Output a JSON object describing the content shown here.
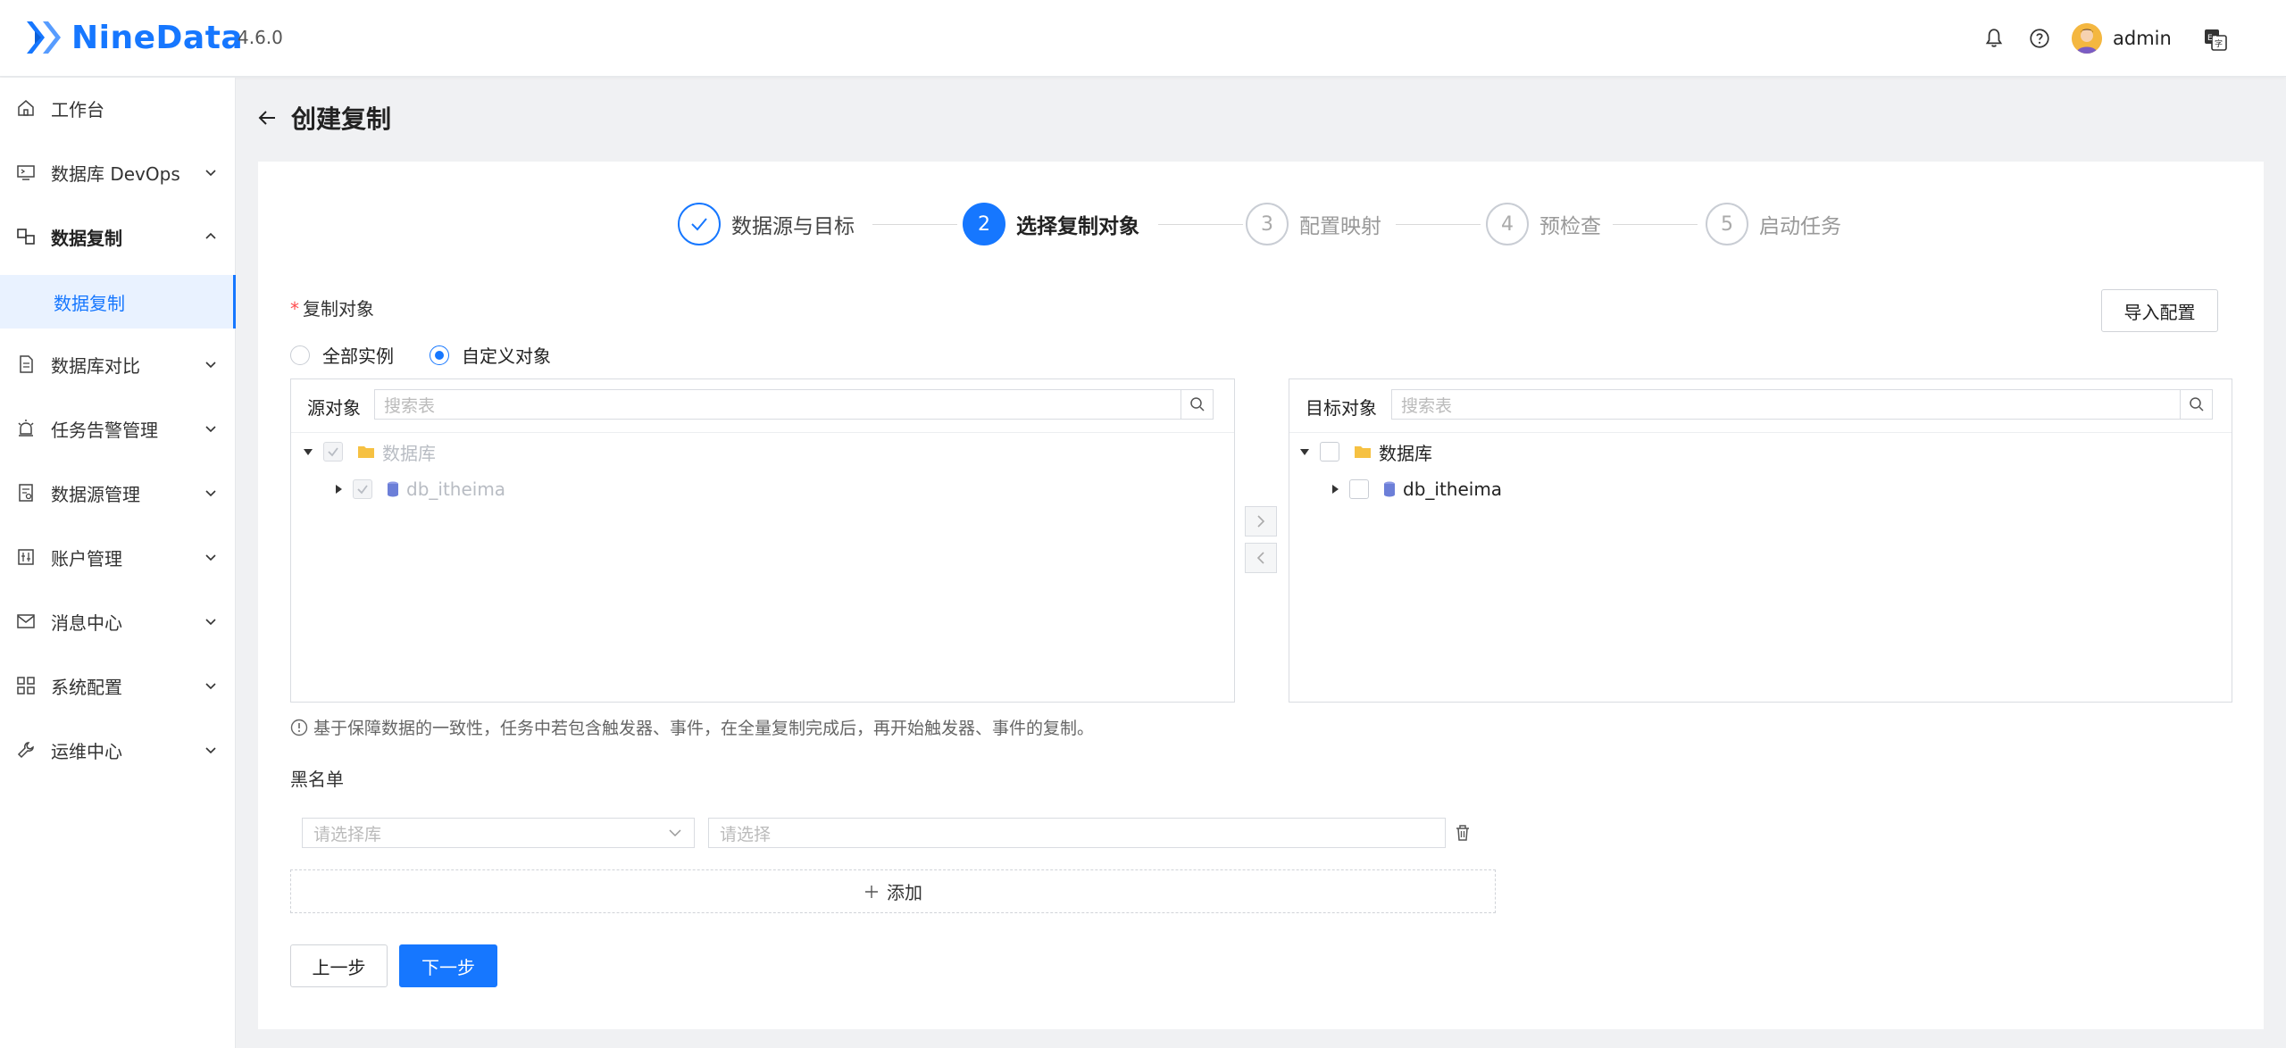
{
  "app": {
    "name": "NineData",
    "version": "4.6.0",
    "user": "admin"
  },
  "sidebar": {
    "items": [
      {
        "label": "工作台"
      },
      {
        "label": "数据库 DevOps"
      },
      {
        "label": "数据复制"
      },
      {
        "label": "数据复制"
      },
      {
        "label": "数据库对比"
      },
      {
        "label": "任务告警管理"
      },
      {
        "label": "数据源管理"
      },
      {
        "label": "账户管理"
      },
      {
        "label": "消息中心"
      },
      {
        "label": "系统配置"
      },
      {
        "label": "运维中心"
      }
    ]
  },
  "page": {
    "title": "创建复制"
  },
  "steps": [
    {
      "num": "",
      "label": "数据源与目标",
      "state": "done"
    },
    {
      "num": "2",
      "label": "选择复制对象",
      "state": "active"
    },
    {
      "num": "3",
      "label": "配置映射",
      "state": "pending"
    },
    {
      "num": "4",
      "label": "预检查",
      "state": "pending"
    },
    {
      "num": "5",
      "label": "启动任务",
      "state": "pending"
    }
  ],
  "form": {
    "required_star": "*",
    "object_label": "复制对象",
    "import_button": "导入配置",
    "radio_all": "全部实例",
    "radio_custom": "自定义对象",
    "selected_radio": "自定义对象"
  },
  "source_panel": {
    "title": "源对象",
    "search_placeholder": "搜索表",
    "tree": [
      {
        "label": "数据库",
        "checked": true,
        "disabled": true
      },
      {
        "label": "db_itheima",
        "checked": true,
        "disabled": true
      }
    ]
  },
  "target_panel": {
    "title": "目标对象",
    "search_placeholder": "搜索表",
    "tree": [
      {
        "label": "数据库",
        "checked": false
      },
      {
        "label": "db_itheima",
        "checked": false
      }
    ]
  },
  "note": "基于保障数据的一致性，任务中若包含触发器、事件，在全量复制完成后，再开始触发器、事件的复制。",
  "blacklist": {
    "label": "黑名单",
    "db_placeholder": "请选择库",
    "item_placeholder": "请选择",
    "add_label": "添加"
  },
  "footer": {
    "prev": "上一步",
    "next": "下一步"
  },
  "colors": {
    "primary": "#1677ff",
    "required": "#ff4d4f",
    "folder": "#f6c142",
    "db": "#6c7fd8"
  }
}
